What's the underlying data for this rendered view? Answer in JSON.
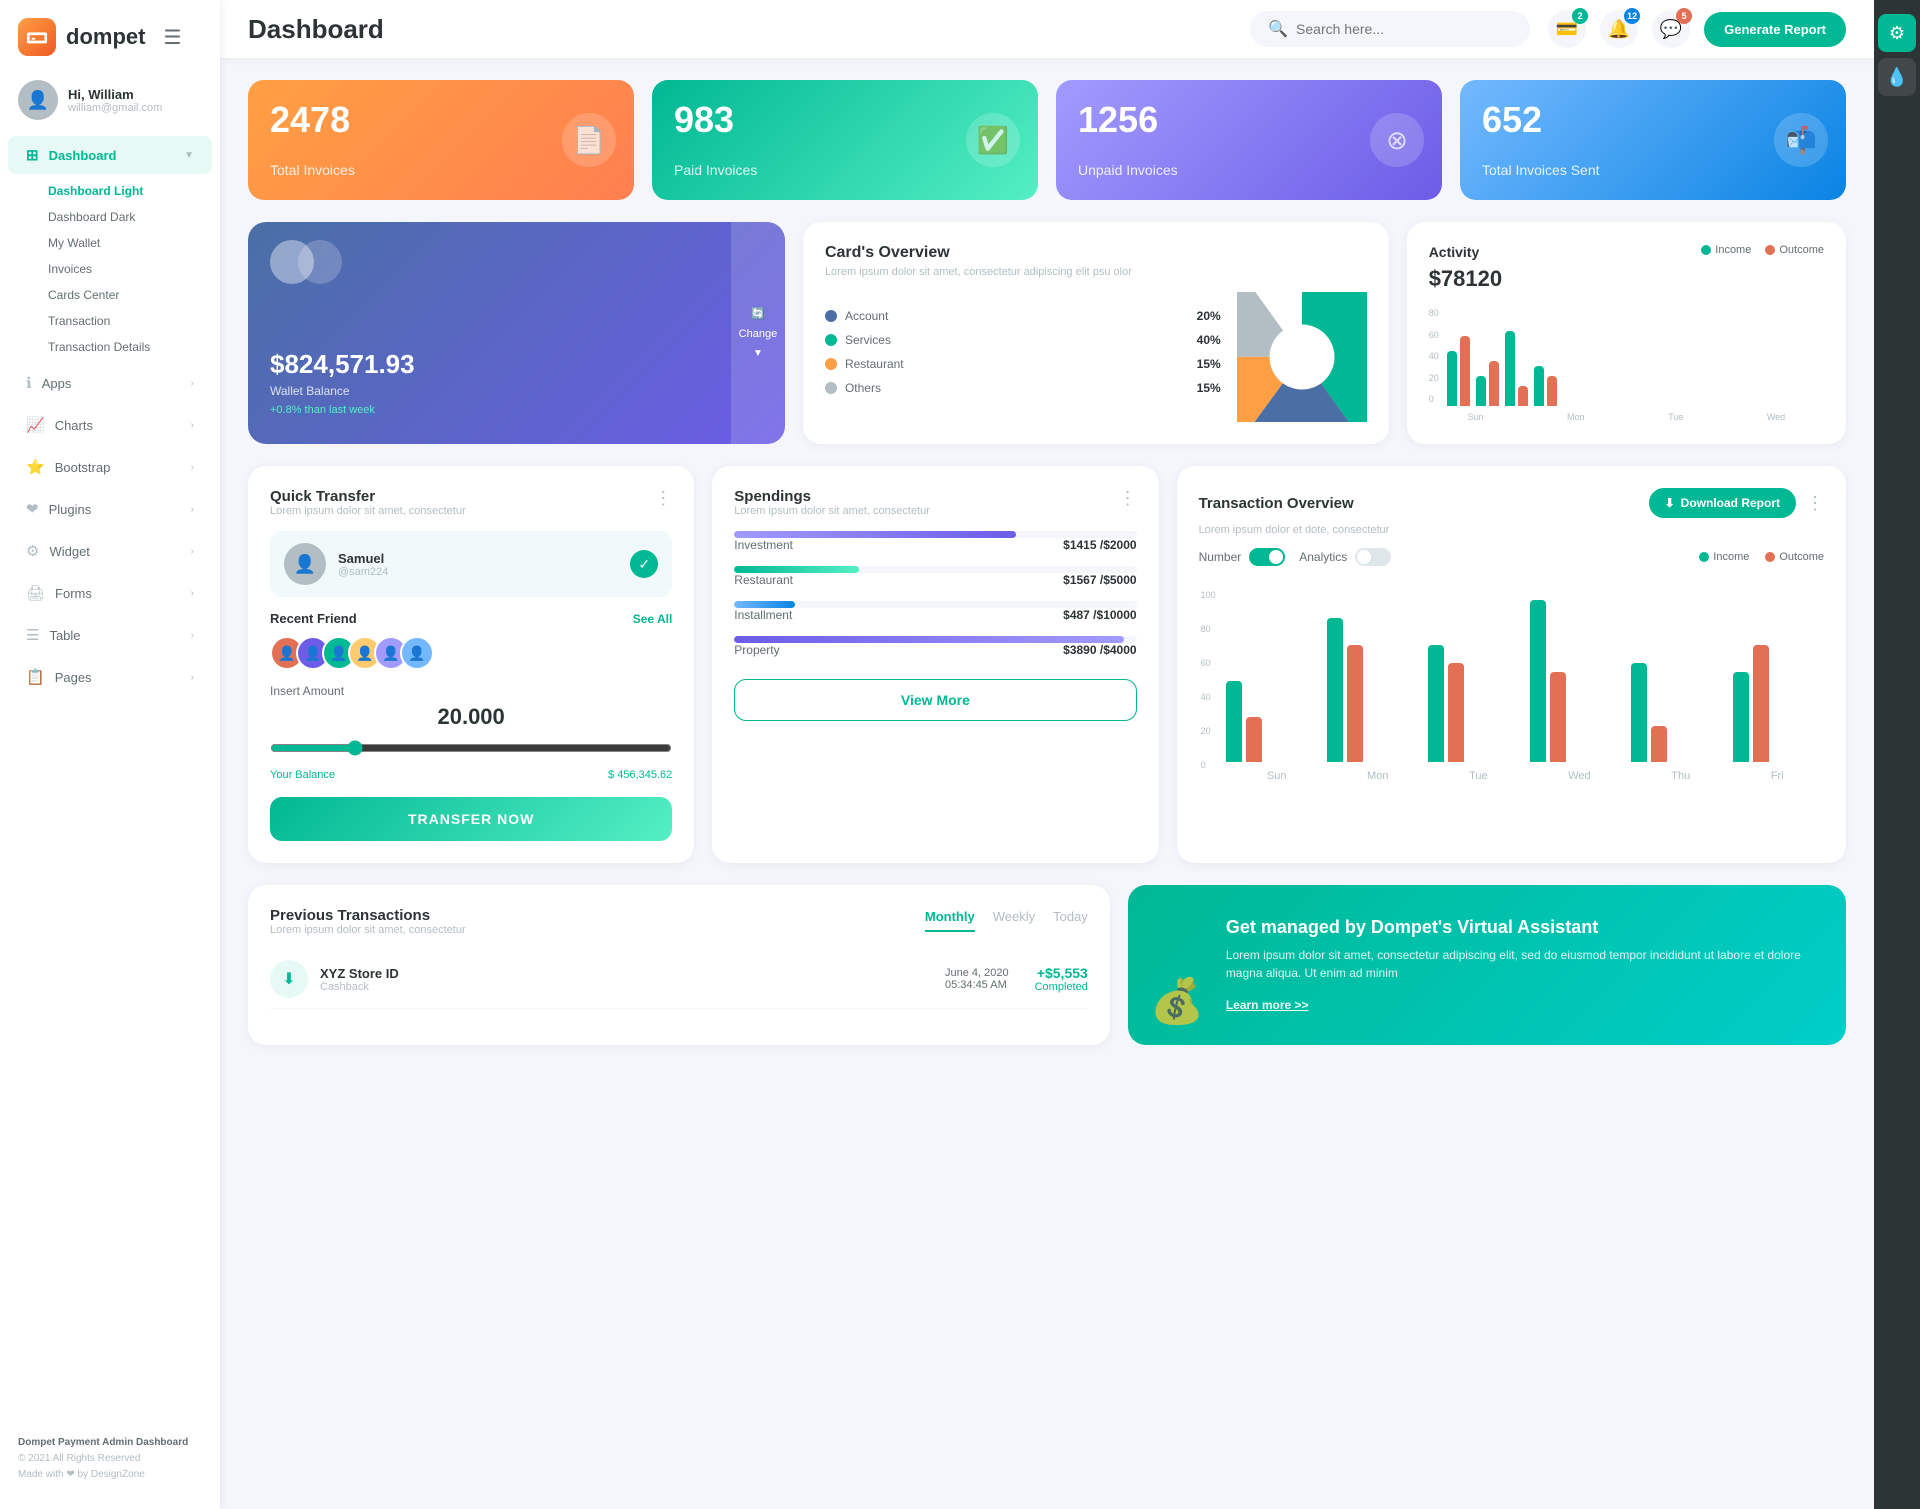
{
  "app": {
    "name": "dompet",
    "title": "Dashboard"
  },
  "header": {
    "search_placeholder": "Search here...",
    "generate_btn": "Generate Report",
    "badges": {
      "wallet": "2",
      "bell": "12",
      "chat": "5"
    }
  },
  "user": {
    "greeting": "Hi,",
    "name": "William",
    "email": "william@gmail.com"
  },
  "sidebar": {
    "dashboard_label": "Dashboard",
    "sub_items": [
      {
        "label": "Dashboard Light",
        "active": true
      },
      {
        "label": "Dashboard Dark"
      },
      {
        "label": "My Wallet"
      },
      {
        "label": "Invoices"
      },
      {
        "label": "Cards Center"
      },
      {
        "label": "Transaction"
      },
      {
        "label": "Transaction Details"
      }
    ],
    "nav_items": [
      {
        "label": "Apps",
        "icon": "ℹ"
      },
      {
        "label": "Charts",
        "icon": "📈"
      },
      {
        "label": "Bootstrap",
        "icon": "⭐"
      },
      {
        "label": "Plugins",
        "icon": "❤"
      },
      {
        "label": "Widget",
        "icon": "⚙"
      },
      {
        "label": "Forms",
        "icon": "🖨"
      },
      {
        "label": "Table",
        "icon": "☰"
      },
      {
        "label": "Pages",
        "icon": "📋"
      }
    ],
    "footer": {
      "brand": "Dompet Payment Admin Dashboard",
      "copyright": "© 2021 All Rights Reserved",
      "made_with": "Made with ❤ by DesignZone"
    }
  },
  "stats": [
    {
      "number": "2478",
      "label": "Total Invoices",
      "color": "orange"
    },
    {
      "number": "983",
      "label": "Paid Invoices",
      "color": "green"
    },
    {
      "number": "1256",
      "label": "Unpaid Invoices",
      "color": "purple"
    },
    {
      "number": "652",
      "label": "Total Invoices Sent",
      "color": "blue"
    }
  ],
  "wallet": {
    "amount": "$824,571.93",
    "label": "Wallet Balance",
    "change": "+0.8% than last week",
    "change_btn": "Change"
  },
  "card_overview": {
    "title": "Card's Overview",
    "subtitle": "Lorem ipsum dolor sit amet, consectetur adipiscing elit psu olor",
    "segments": [
      {
        "label": "Account",
        "value": "20%",
        "color": "#4a6fa5"
      },
      {
        "label": "Services",
        "value": "40%",
        "color": "#00b894"
      },
      {
        "label": "Restaurant",
        "value": "15%",
        "color": "#ff9f43"
      },
      {
        "label": "Others",
        "value": "15%",
        "color": "#b2bec3"
      }
    ]
  },
  "activity": {
    "title": "Activity",
    "amount": "$78120",
    "legend": [
      {
        "label": "Income",
        "color": "#00b894"
      },
      {
        "label": "Outcome",
        "color": "#e17055"
      }
    ],
    "bars": [
      {
        "day": "Sun",
        "income": 55,
        "outcome": 70
      },
      {
        "day": "Mon",
        "income": 30,
        "outcome": 45
      },
      {
        "day": "Tue",
        "income": 75,
        "outcome": 20
      },
      {
        "day": "Wed",
        "income": 40,
        "outcome": 30
      }
    ]
  },
  "quick_transfer": {
    "title": "Quick Transfer",
    "subtitle": "Lorem ipsum dolor sit amet, consectetur",
    "contact": {
      "name": "Samuel",
      "handle": "@sam224"
    },
    "recent_friend_label": "Recent Friend",
    "see_all": "See All",
    "insert_amount_label": "Insert Amount",
    "amount": "20.000",
    "your_balance_label": "Your Balance",
    "balance": "$ 456,345.62",
    "transfer_btn": "TRANSFER NOW"
  },
  "spendings": {
    "title": "Spendings",
    "subtitle": "Lorem ipsum dolor sit amet, consectetur",
    "items": [
      {
        "label": "Investment",
        "amount": "$1415",
        "total": "$2000",
        "pct": 70,
        "color": "#a29bfe"
      },
      {
        "label": "Restaurant",
        "amount": "$1567",
        "total": "$5000",
        "pct": 31,
        "color": "#00b894"
      },
      {
        "label": "Installment",
        "amount": "$487",
        "total": "$10000",
        "pct": 15,
        "color": "#74b9ff"
      },
      {
        "label": "Property",
        "amount": "$3890",
        "total": "$4000",
        "pct": 97,
        "color": "#6c5ce7"
      }
    ],
    "view_more_btn": "View More"
  },
  "transaction_overview": {
    "title": "Transaction Overview",
    "subtitle": "Lorem ipsum dolor et dote, consectetur",
    "download_btn": "Download Report",
    "toggle_number_label": "Number",
    "toggle_analytics_label": "Analytics",
    "legend": [
      {
        "label": "Income",
        "color": "#00b894"
      },
      {
        "label": "Outcome",
        "color": "#e17055"
      }
    ],
    "bars": [
      {
        "day": "Sun",
        "income": 45,
        "outcome": 25
      },
      {
        "day": "Mon",
        "income": 80,
        "outcome": 65
      },
      {
        "day": "Tue",
        "income": 65,
        "outcome": 55
      },
      {
        "day": "Wed",
        "income": 90,
        "outcome": 50
      },
      {
        "day": "Thu",
        "income": 55,
        "outcome": 20
      },
      {
        "day": "Fri",
        "income": 50,
        "outcome": 65
      }
    ],
    "y_labels": [
      "100",
      "80",
      "60",
      "40",
      "20",
      "0"
    ]
  },
  "prev_transactions": {
    "title": "Previous Transactions",
    "subtitle": "Lorem ipsum dolor sit amet, consectetur",
    "tabs": [
      "Monthly",
      "Weekly",
      "Today"
    ],
    "active_tab": "Monthly",
    "items": [
      {
        "name": "XYZ Store ID",
        "type": "Cashback",
        "date": "June 4, 2020",
        "time": "05:34:45 AM",
        "amount": "+$5,553",
        "status": "Completed",
        "icon_type": "green"
      }
    ]
  },
  "virtual_assistant": {
    "title": "Get managed by Dompet's Virtual Assistant",
    "desc": "Lorem ipsum dolor sit amet, consectetur adipiscing elit, sed do eiusmod tempor incididunt ut labore et dolore magna aliqua. Ut enim ad minim",
    "link": "Learn more >>"
  }
}
